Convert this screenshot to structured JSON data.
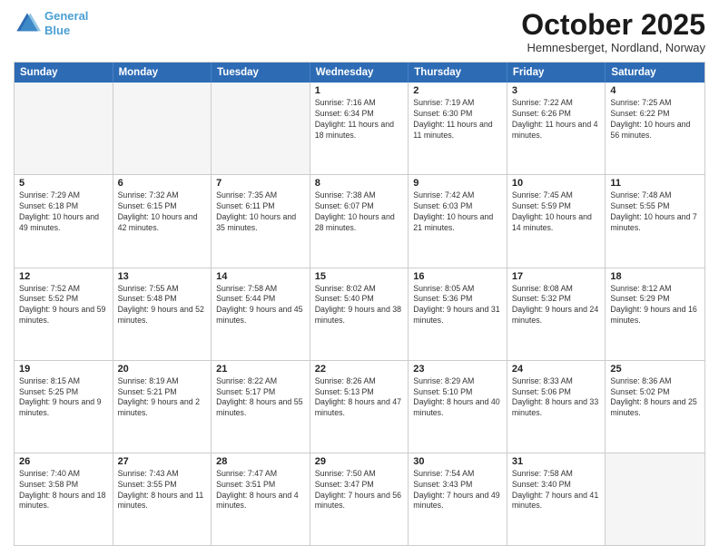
{
  "logo": {
    "line1": "General",
    "line2": "Blue"
  },
  "header": {
    "title": "October 2025",
    "subtitle": "Hemnesberget, Nordland, Norway"
  },
  "days": [
    "Sunday",
    "Monday",
    "Tuesday",
    "Wednesday",
    "Thursday",
    "Friday",
    "Saturday"
  ],
  "weeks": [
    [
      {
        "day": "",
        "content": ""
      },
      {
        "day": "",
        "content": ""
      },
      {
        "day": "",
        "content": ""
      },
      {
        "day": "1",
        "content": "Sunrise: 7:16 AM\nSunset: 6:34 PM\nDaylight: 11 hours\nand 18 minutes."
      },
      {
        "day": "2",
        "content": "Sunrise: 7:19 AM\nSunset: 6:30 PM\nDaylight: 11 hours\nand 11 minutes."
      },
      {
        "day": "3",
        "content": "Sunrise: 7:22 AM\nSunset: 6:26 PM\nDaylight: 11 hours\nand 4 minutes."
      },
      {
        "day": "4",
        "content": "Sunrise: 7:25 AM\nSunset: 6:22 PM\nDaylight: 10 hours\nand 56 minutes."
      }
    ],
    [
      {
        "day": "5",
        "content": "Sunrise: 7:29 AM\nSunset: 6:18 PM\nDaylight: 10 hours\nand 49 minutes."
      },
      {
        "day": "6",
        "content": "Sunrise: 7:32 AM\nSunset: 6:15 PM\nDaylight: 10 hours\nand 42 minutes."
      },
      {
        "day": "7",
        "content": "Sunrise: 7:35 AM\nSunset: 6:11 PM\nDaylight: 10 hours\nand 35 minutes."
      },
      {
        "day": "8",
        "content": "Sunrise: 7:38 AM\nSunset: 6:07 PM\nDaylight: 10 hours\nand 28 minutes."
      },
      {
        "day": "9",
        "content": "Sunrise: 7:42 AM\nSunset: 6:03 PM\nDaylight: 10 hours\nand 21 minutes."
      },
      {
        "day": "10",
        "content": "Sunrise: 7:45 AM\nSunset: 5:59 PM\nDaylight: 10 hours\nand 14 minutes."
      },
      {
        "day": "11",
        "content": "Sunrise: 7:48 AM\nSunset: 5:55 PM\nDaylight: 10 hours\nand 7 minutes."
      }
    ],
    [
      {
        "day": "12",
        "content": "Sunrise: 7:52 AM\nSunset: 5:52 PM\nDaylight: 9 hours\nand 59 minutes."
      },
      {
        "day": "13",
        "content": "Sunrise: 7:55 AM\nSunset: 5:48 PM\nDaylight: 9 hours\nand 52 minutes."
      },
      {
        "day": "14",
        "content": "Sunrise: 7:58 AM\nSunset: 5:44 PM\nDaylight: 9 hours\nand 45 minutes."
      },
      {
        "day": "15",
        "content": "Sunrise: 8:02 AM\nSunset: 5:40 PM\nDaylight: 9 hours\nand 38 minutes."
      },
      {
        "day": "16",
        "content": "Sunrise: 8:05 AM\nSunset: 5:36 PM\nDaylight: 9 hours\nand 31 minutes."
      },
      {
        "day": "17",
        "content": "Sunrise: 8:08 AM\nSunset: 5:32 PM\nDaylight: 9 hours\nand 24 minutes."
      },
      {
        "day": "18",
        "content": "Sunrise: 8:12 AM\nSunset: 5:29 PM\nDaylight: 9 hours\nand 16 minutes."
      }
    ],
    [
      {
        "day": "19",
        "content": "Sunrise: 8:15 AM\nSunset: 5:25 PM\nDaylight: 9 hours\nand 9 minutes."
      },
      {
        "day": "20",
        "content": "Sunrise: 8:19 AM\nSunset: 5:21 PM\nDaylight: 9 hours\nand 2 minutes."
      },
      {
        "day": "21",
        "content": "Sunrise: 8:22 AM\nSunset: 5:17 PM\nDaylight: 8 hours\nand 55 minutes."
      },
      {
        "day": "22",
        "content": "Sunrise: 8:26 AM\nSunset: 5:13 PM\nDaylight: 8 hours\nand 47 minutes."
      },
      {
        "day": "23",
        "content": "Sunrise: 8:29 AM\nSunset: 5:10 PM\nDaylight: 8 hours\nand 40 minutes."
      },
      {
        "day": "24",
        "content": "Sunrise: 8:33 AM\nSunset: 5:06 PM\nDaylight: 8 hours\nand 33 minutes."
      },
      {
        "day": "25",
        "content": "Sunrise: 8:36 AM\nSunset: 5:02 PM\nDaylight: 8 hours\nand 25 minutes."
      }
    ],
    [
      {
        "day": "26",
        "content": "Sunrise: 7:40 AM\nSunset: 3:58 PM\nDaylight: 8 hours\nand 18 minutes."
      },
      {
        "day": "27",
        "content": "Sunrise: 7:43 AM\nSunset: 3:55 PM\nDaylight: 8 hours\nand 11 minutes."
      },
      {
        "day": "28",
        "content": "Sunrise: 7:47 AM\nSunset: 3:51 PM\nDaylight: 8 hours\nand 4 minutes."
      },
      {
        "day": "29",
        "content": "Sunrise: 7:50 AM\nSunset: 3:47 PM\nDaylight: 7 hours\nand 56 minutes."
      },
      {
        "day": "30",
        "content": "Sunrise: 7:54 AM\nSunset: 3:43 PM\nDaylight: 7 hours\nand 49 minutes."
      },
      {
        "day": "31",
        "content": "Sunrise: 7:58 AM\nSunset: 3:40 PM\nDaylight: 7 hours\nand 41 minutes."
      },
      {
        "day": "",
        "content": ""
      }
    ]
  ]
}
